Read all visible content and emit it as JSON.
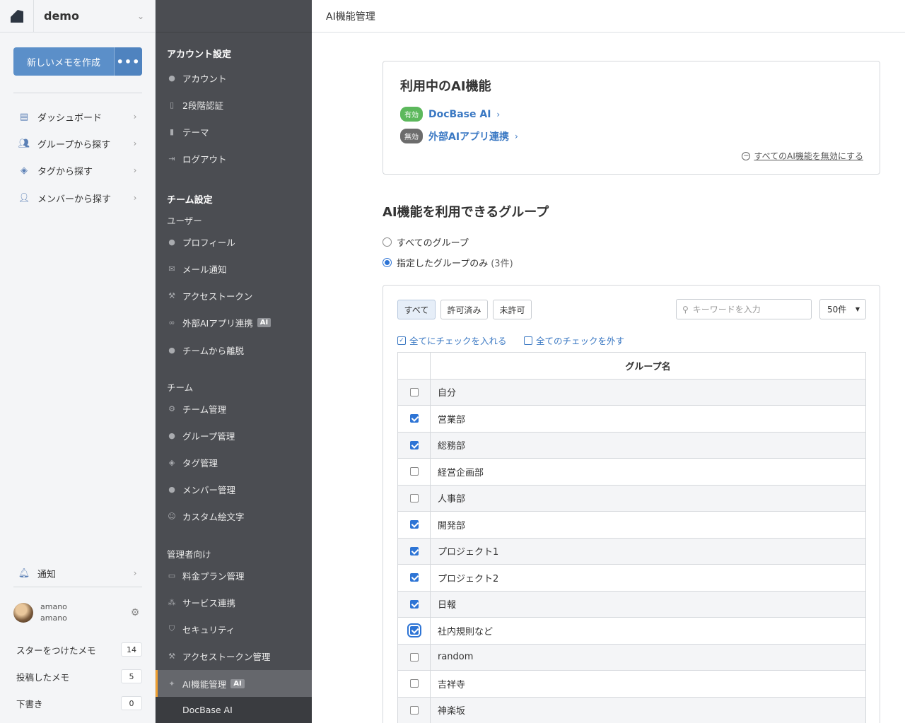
{
  "team": {
    "name": "demo"
  },
  "left": {
    "new_memo": "新しいメモを作成",
    "more": "•••",
    "nav": [
      {
        "label": "ダッシュボード",
        "icon": "document-icon"
      },
      {
        "label": "グループから探す",
        "icon": "group-icon"
      },
      {
        "label": "タグから探す",
        "icon": "tag-icon"
      },
      {
        "label": "メンバーから探す",
        "icon": "members-icon"
      }
    ],
    "notify": "通知",
    "user": {
      "name": "amano",
      "id": "amano"
    },
    "stats": [
      {
        "label": "スターをつけたメモ",
        "count": "14"
      },
      {
        "label": "投稿したメモ",
        "count": "5"
      },
      {
        "label": "下書き",
        "count": "0"
      }
    ]
  },
  "menu": {
    "account_title": "アカウント設定",
    "account_items": [
      "アカウント",
      "2段階認証",
      "テーマ",
      "ログアウト"
    ],
    "team_title": "チーム設定",
    "user_sub": "ユーザー",
    "user_items": [
      "プロフィール",
      "メール通知",
      "アクセストークン",
      "外部AIアプリ連携",
      "チームから離脱"
    ],
    "team_sub": "チーム",
    "team_items": [
      "チーム管理",
      "グループ管理",
      "タグ管理",
      "メンバー管理",
      "カスタム絵文字"
    ],
    "admin_sub": "管理者向け",
    "admin_items": [
      "料金プラン管理",
      "サービス連携",
      "セキュリティ",
      "アクセストークン管理",
      "AI機能管理"
    ],
    "ai_badge": "AI",
    "submenu": "DocBase AI"
  },
  "main": {
    "header": "AI機能管理",
    "ai_card": {
      "title": "利用中のAI機能",
      "features": [
        {
          "badge": "有効",
          "label": "DocBase AI",
          "enabled": true
        },
        {
          "badge": "無効",
          "label": "外部AIアプリ連携",
          "enabled": false
        }
      ],
      "disable_all": "すべてのAI機能を無効にする"
    },
    "groups": {
      "title": "AI機能を利用できるグループ",
      "radio_all": "すべてのグループ",
      "radio_selected": "指定したグループのみ",
      "radio_count": "(3件)",
      "filters": [
        "すべて",
        "許可済み",
        "未許可"
      ],
      "search_placeholder": "キーワードを入力",
      "per_page": "50件",
      "check_all": "全てにチェックを入れる",
      "uncheck_all": "全てのチェックを外す",
      "column": "グループ名",
      "rows": [
        {
          "name": "自分",
          "checked": false
        },
        {
          "name": "営業部",
          "checked": true
        },
        {
          "name": "総務部",
          "checked": true
        },
        {
          "name": "経営企画部",
          "checked": false
        },
        {
          "name": "人事部",
          "checked": false
        },
        {
          "name": "開発部",
          "checked": true
        },
        {
          "name": "プロジェクト1",
          "checked": true
        },
        {
          "name": "プロジェクト2",
          "checked": true
        },
        {
          "name": "日報",
          "checked": true
        },
        {
          "name": "社内規則など",
          "checked": true
        },
        {
          "name": "random",
          "checked": false
        },
        {
          "name": "吉祥寺",
          "checked": false
        },
        {
          "name": "神楽坂",
          "checked": false
        }
      ]
    }
  },
  "colors": {
    "accent": "#2d74d5",
    "primary_button": "#5b8fc9",
    "menu_bg": "#4b4d52",
    "active_marker": "#f0a030",
    "enabled_badge": "#5cb85c"
  }
}
